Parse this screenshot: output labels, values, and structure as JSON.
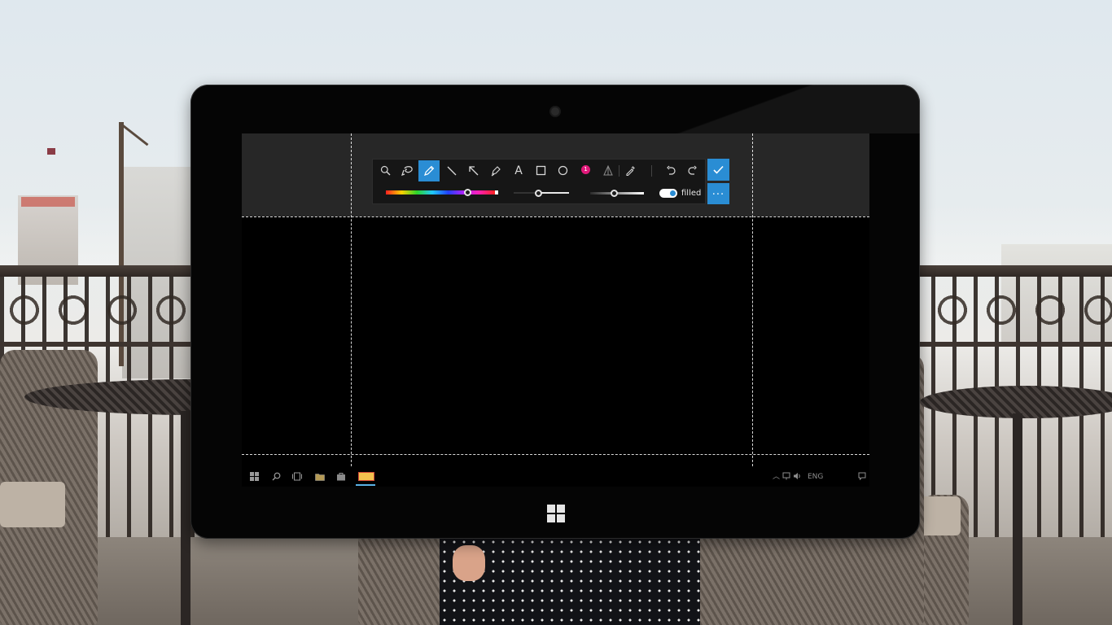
{
  "toolbar": {
    "tools": [
      {
        "id": "zoom",
        "icon": "magnifier-icon"
      },
      {
        "id": "select",
        "icon": "lasso-icon"
      },
      {
        "id": "pen",
        "icon": "pen-icon",
        "active": true
      },
      {
        "id": "line",
        "icon": "line-icon"
      },
      {
        "id": "arrow",
        "icon": "arrow-icon"
      },
      {
        "id": "highlighter",
        "icon": "highlighter-icon"
      },
      {
        "id": "text",
        "icon": "text-icon",
        "glyph": "A"
      },
      {
        "id": "rectangle",
        "icon": "rectangle-icon"
      },
      {
        "id": "ellipse",
        "icon": "ellipse-icon"
      },
      {
        "id": "step-number",
        "icon": "step-number-icon",
        "glyph": "1"
      },
      {
        "id": "blur",
        "icon": "blur-icon"
      },
      {
        "id": "color-picker",
        "icon": "eyedropper-icon"
      },
      {
        "id": "undo",
        "icon": "undo-icon"
      },
      {
        "id": "redo",
        "icon": "redo-icon"
      }
    ],
    "color_hue_fraction": 0.75,
    "stroke_width_fraction": 0.45,
    "opacity_fraction": 0.45,
    "filled_label": "filled",
    "filled_on": true,
    "confirm_icon": "check-icon",
    "more_label": "..."
  },
  "taskbar": {
    "icons": [
      "windows-start-icon",
      "search-icon",
      "task-view-icon",
      "file-explorer-icon",
      "store-icon",
      "app-icon"
    ],
    "tray_language": "ENG",
    "tray_icons": [
      "chevron-up-icon",
      "network-icon",
      "volume-icon",
      "notification-icon"
    ]
  },
  "colors": {
    "accent": "#2a8dd4",
    "step_badge": "#e0187a",
    "toolbar_bg": "#161616"
  }
}
